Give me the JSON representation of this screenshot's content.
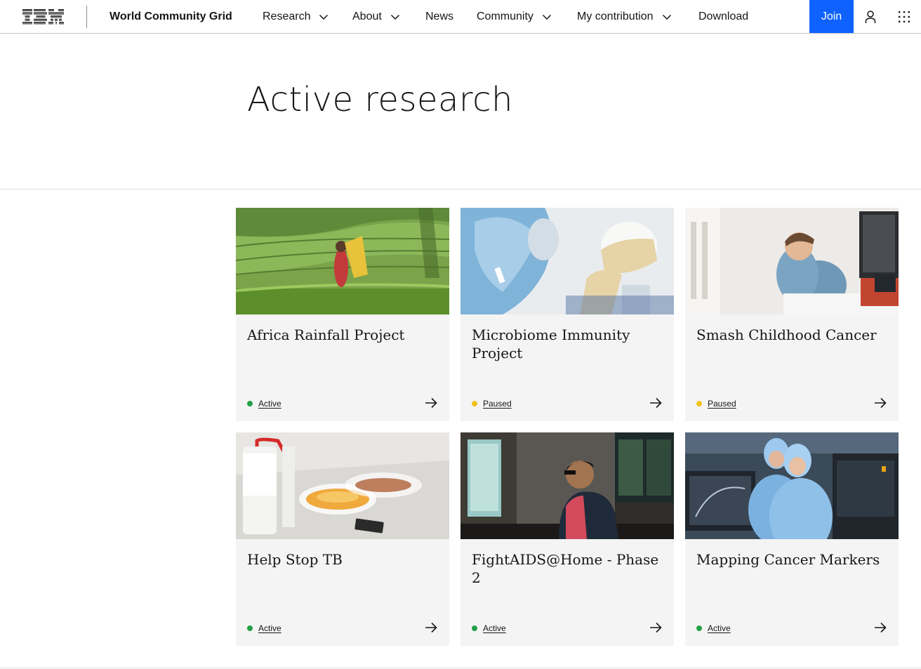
{
  "header": {
    "logo_text": "IBM",
    "site_name": "World Community Grid",
    "nav": [
      {
        "label": "Research",
        "has_dropdown": true
      },
      {
        "label": "About",
        "has_dropdown": true
      },
      {
        "label": "News",
        "has_dropdown": false
      },
      {
        "label": "Community",
        "has_dropdown": true
      },
      {
        "label": "My contribution",
        "has_dropdown": true
      },
      {
        "label": "Download",
        "has_dropdown": false
      }
    ],
    "join_label": "Join",
    "icons": [
      "user-icon",
      "app-switcher-icon"
    ],
    "accent_color": "#0f62fe"
  },
  "page": {
    "title": "Active research"
  },
  "status_colors": {
    "Active": "#24a148",
    "Paused": "#f1c21b"
  },
  "projects": [
    {
      "title": "Africa Rainfall Project",
      "status": "Active",
      "image": "tea-field-photo"
    },
    {
      "title": "Microbiome Immunity Project",
      "status": "Paused",
      "image": "lab-scientist-photo"
    },
    {
      "title": "Smash Childhood Cancer",
      "status": "Paused",
      "image": "boy-drawing-photo"
    },
    {
      "title": "Help Stop TB",
      "status": "Active",
      "image": "petri-dish-photo"
    },
    {
      "title": "FightAIDS@Home - Phase 2",
      "status": "Active",
      "image": "computer-user-photo"
    },
    {
      "title": "Mapping Cancer Markers",
      "status": "Active",
      "image": "cleanroom-researchers-photo"
    }
  ]
}
